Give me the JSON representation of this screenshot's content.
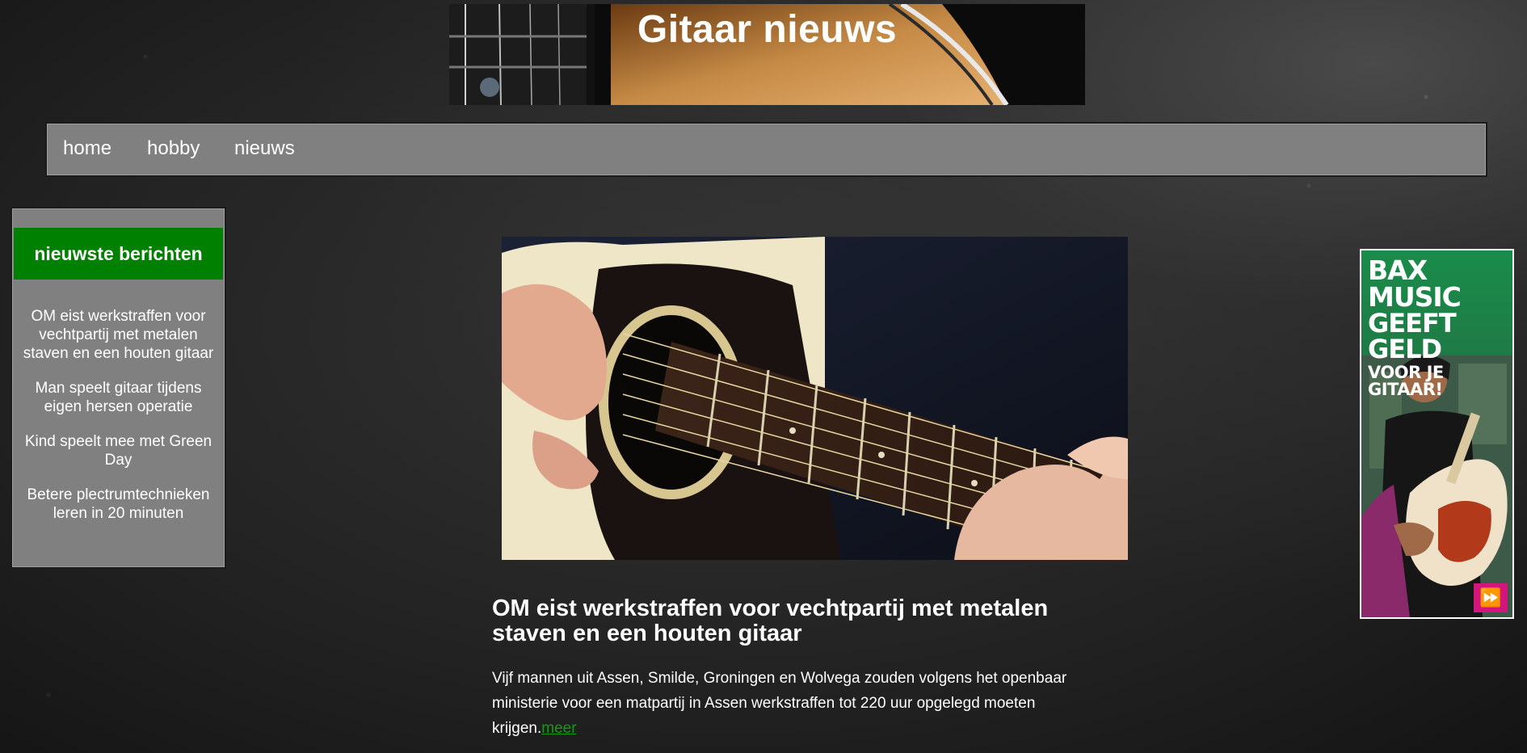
{
  "header": {
    "title": "Gitaar nieuws"
  },
  "nav": {
    "items": [
      {
        "label": "home"
      },
      {
        "label": "hobby"
      },
      {
        "label": "nieuws"
      }
    ]
  },
  "sidebar": {
    "heading": "nieuwste berichten",
    "items": [
      {
        "label": "OM eist werkstraffen voor vechtpartij met metalen staven en een houten gitaar"
      },
      {
        "label": "Man speelt gitaar tijdens eigen hersen operatie"
      },
      {
        "label": "Kind speelt mee met Green Day"
      },
      {
        "label": "Betere plectrumtechnieken leren in 20 minuten"
      }
    ]
  },
  "article": {
    "title": "OM eist werkstraffen voor vechtpartij met metalen staven en een houten gitaar",
    "text": "Vijf mannen uit Assen, Smilde, Groningen en Wolvega zouden volgens het openbaar ministerie voor een matpartij in Assen werkstraffen tot 220 uur opgelegd moeten krijgen.",
    "more_link": "meer"
  },
  "ad": {
    "line1": "BAX MUSIC",
    "line2": "GEEFT GELD",
    "line3": "VOOR JE GITAAR!",
    "play_icon": "fast-forward-icon"
  },
  "colors": {
    "nav_bg": "#808080",
    "sidebar_heading_bg": "#008000",
    "link_green": "#129a12",
    "ad_accent": "#d4157c"
  }
}
